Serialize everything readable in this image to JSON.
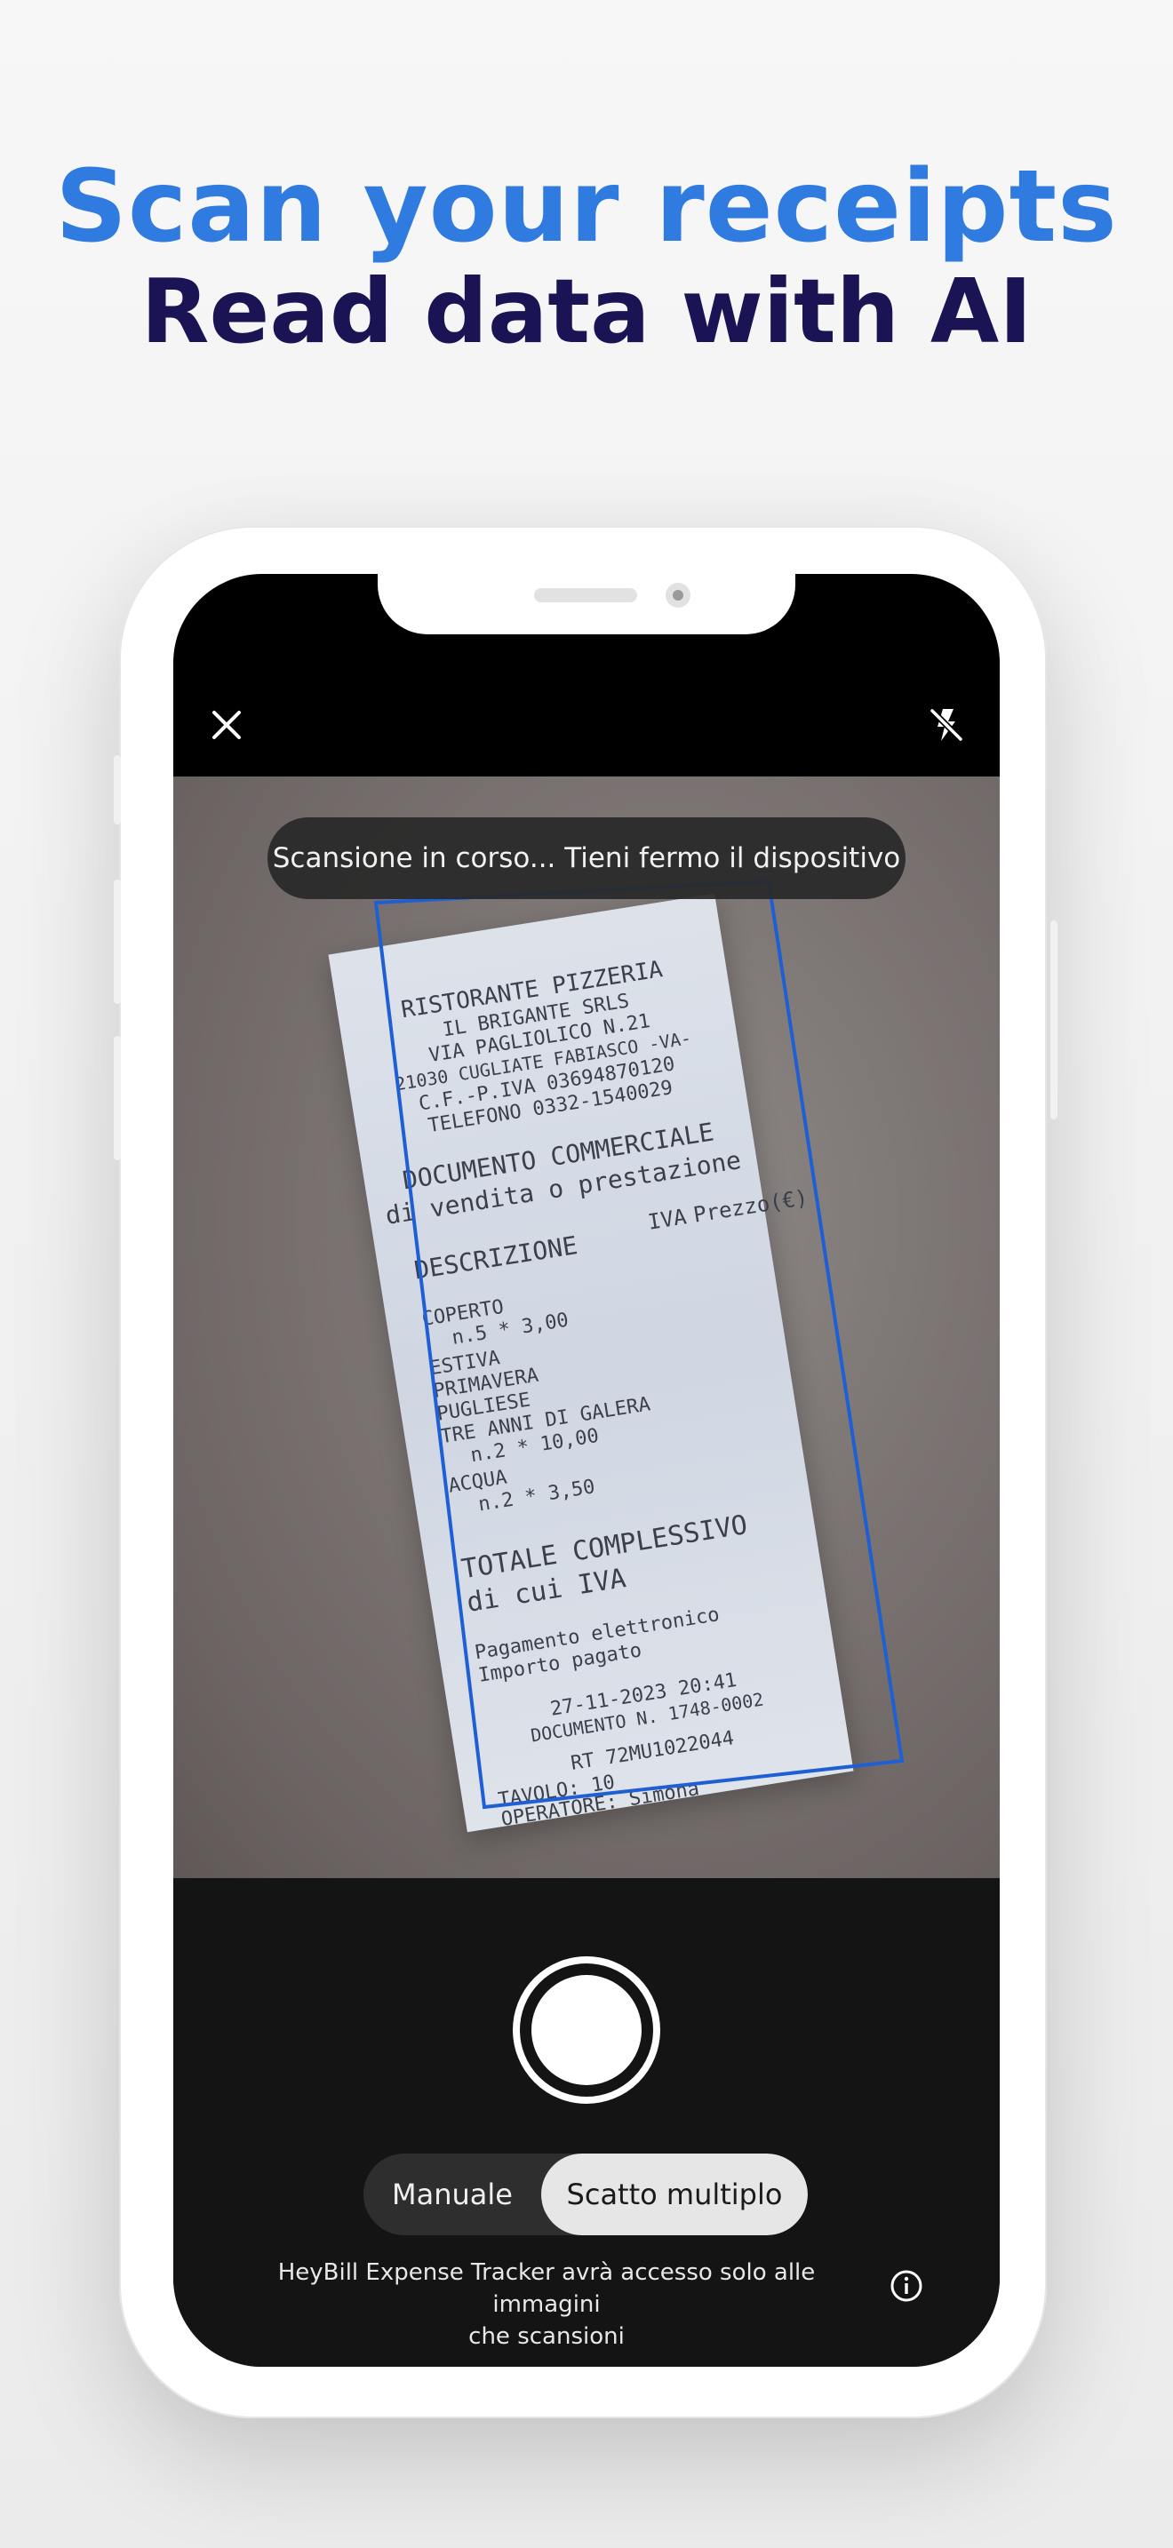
{
  "headline": {
    "primary": "Scan your receipts",
    "secondary": "Read data with AI"
  },
  "colors": {
    "primary_headline": "#2f7be0",
    "secondary_headline": "#1a1454",
    "scan_frame": "#1f5fd4",
    "bottom_bar": "#141414"
  },
  "scanner": {
    "close_icon": "close-icon",
    "flash_icon": "flash-off-icon",
    "status_message": "Scansione in corso... Tieni fermo il dispositivo",
    "receipt_lines": [
      "RISTORANTE PIZZERIA",
      "IL BRIGANTE SRLS",
      "VIA PAGLIOLICO N.21",
      "21030 CUGLIATE FABIASCO -VA-",
      "C.F.-P.IVA 03694870120",
      "TELEFONO 0332-1540029",
      "DOCUMENTO COMMERCIALE",
      "di vendita o prestazione",
      "DESCRIZIONE",
      "IVA",
      "Prezzo(€)",
      "COPERTO",
      "n.5 * 3,00",
      "ESTIVA",
      "PRIMAVERA",
      "PUGLIESE",
      "TRE ANNI DI GALERA",
      "n.2 * 10,00",
      "ACQUA",
      "n.2 * 3,50",
      "TOTALE COMPLESSIVO",
      "di cui IVA",
      "Pagamento elettronico",
      "Importo pagato",
      "27-11-2023 20:41",
      "DOCUMENTO N. 1748-0002",
      "RT 72MU1022044",
      "TAVOLO: 10",
      "OPERATORE: Simona"
    ],
    "shutter_label": "shutter",
    "modes": {
      "manual": "Manuale",
      "multi": "Scatto multiplo",
      "selected": "Scatto multiplo"
    },
    "access_note_line1": "HeyBill Expense Tracker avrà accesso solo alle immagini",
    "access_note_line2": "che scansioni",
    "info_icon": "info-icon"
  }
}
